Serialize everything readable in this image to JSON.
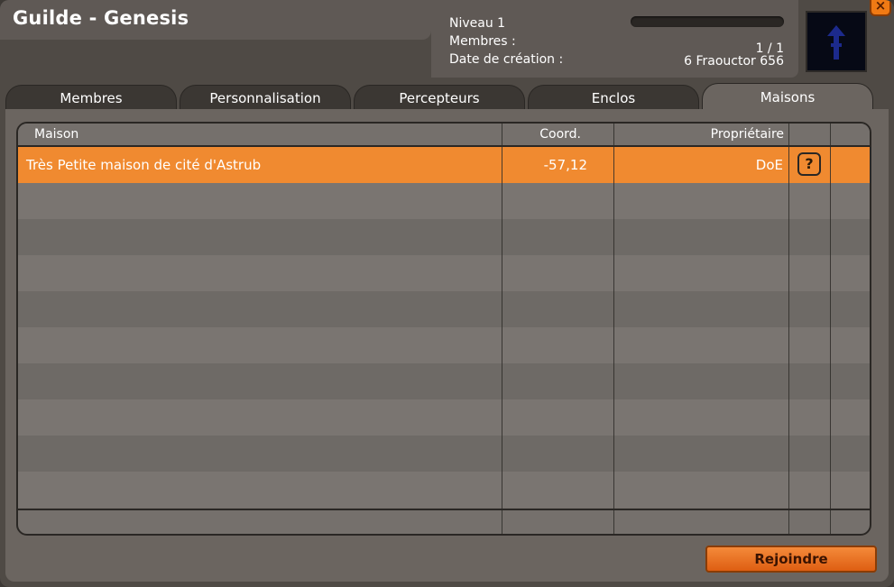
{
  "window": {
    "title": "Guilde - Genesis",
    "close_label": "×"
  },
  "info": {
    "level_label": "Niveau 1",
    "level_progress": 0,
    "members_label": "Membres :",
    "members_value": "1 / 1",
    "creation_label": "Date de création :",
    "creation_value": "6 Fraouctor 656"
  },
  "tabs": [
    {
      "label": "Membres",
      "active": false
    },
    {
      "label": "Personnalisation",
      "active": false
    },
    {
      "label": "Percepteurs",
      "active": false
    },
    {
      "label": "Enclos",
      "active": false
    },
    {
      "label": "Maisons",
      "active": true
    }
  ],
  "table": {
    "columns": [
      "Maison",
      "Coord.",
      "Propriétaire"
    ],
    "rows": [
      {
        "maison": "Très Petite maison de cité d'Astrub",
        "coord": "-57,12",
        "owner": "DoE",
        "action": "?"
      }
    ]
  },
  "actions": {
    "join_label": "Rejoindre"
  },
  "colors": {
    "accent": "#f08a30",
    "panel": "#6b6560",
    "dark": "#2a2724"
  }
}
